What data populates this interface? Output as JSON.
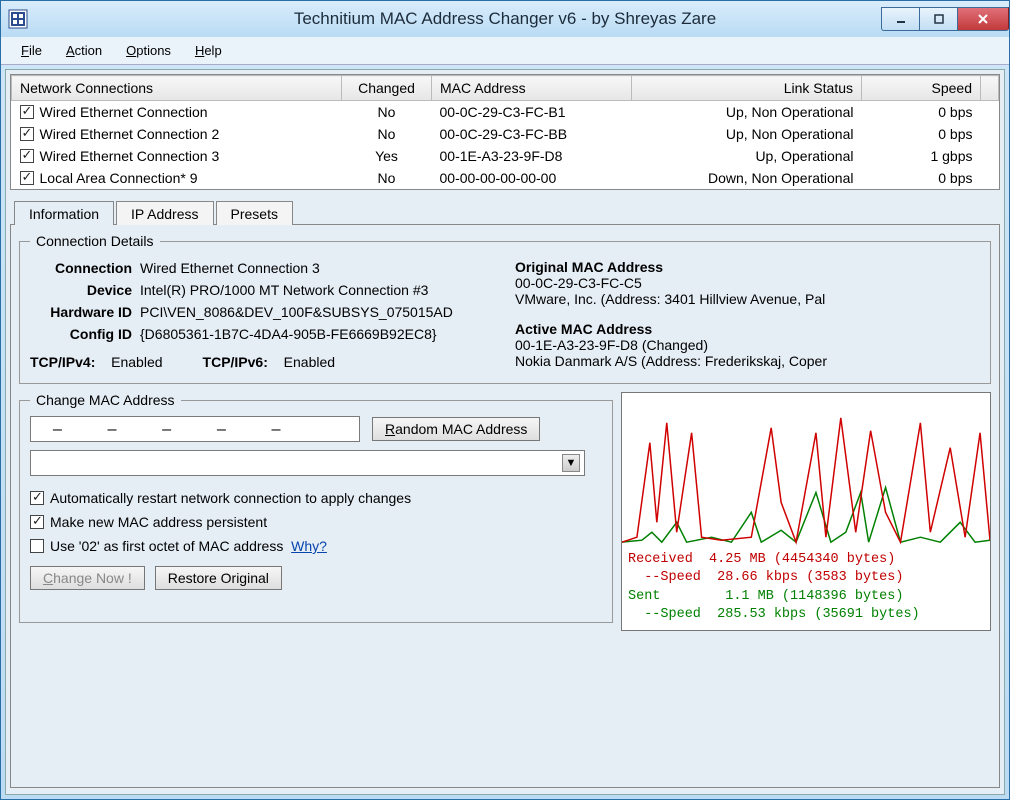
{
  "window": {
    "title": "Technitium MAC Address Changer v6 - by Shreyas Zare"
  },
  "menu": [
    "File",
    "Action",
    "Options",
    "Help"
  ],
  "columns": [
    "Network Connections",
    "Changed",
    "MAC Address",
    "Link Status",
    "Speed"
  ],
  "rows": [
    {
      "name": "Wired Ethernet Connection",
      "changed": "No",
      "mac": "00-0C-29-C3-FC-B1",
      "status": "Up, Non Operational",
      "speed": "0 bps"
    },
    {
      "name": "Wired Ethernet Connection 2",
      "changed": "No",
      "mac": "00-0C-29-C3-FC-BB",
      "status": "Up, Non Operational",
      "speed": "0 bps"
    },
    {
      "name": "Wired Ethernet Connection 3",
      "changed": "Yes",
      "mac": "00-1E-A3-23-9F-D8",
      "status": "Up, Operational",
      "speed": "1 gbps"
    },
    {
      "name": "Local Area Connection* 9",
      "changed": "No",
      "mac": "00-00-00-00-00-00",
      "status": "Down, Non Operational",
      "speed": "0 bps"
    }
  ],
  "tabs": [
    "Information",
    "IP Address",
    "Presets"
  ],
  "fieldset_details": "Connection Details",
  "fieldset_change": "Change MAC Address",
  "details": {
    "connection_lbl": "Connection",
    "connection": "Wired Ethernet Connection 3",
    "device_lbl": "Device",
    "device": "Intel(R) PRO/1000 MT Network Connection #3",
    "hwid_lbl": "Hardware ID",
    "hwid": "PCI\\VEN_8086&DEV_100F&SUBSYS_075015AD",
    "cfgid_lbl": "Config ID",
    "cfgid": "{D6805361-1B7C-4DA4-905B-FE6669B92EC8}",
    "tcpv4_lbl": "TCP/IPv4:",
    "tcpv4": "Enabled",
    "tcpv6_lbl": "TCP/IPv6:",
    "tcpv6": "Enabled",
    "orig_title": "Original MAC Address",
    "orig_mac": "00-0C-29-C3-FC-C5",
    "orig_vendor": "VMware, Inc.  (Address: 3401 Hillview Avenue, Pal",
    "active_title": "Active MAC Address",
    "active_mac": "00-1E-A3-23-9F-D8 (Changed)",
    "active_vendor": "Nokia Danmark A/S  (Address: Frederikskaj, Coper"
  },
  "change": {
    "random_btn": "Random MAC Address",
    "chk_restart": "Automatically restart network connection to apply changes",
    "chk_persist": "Make new MAC address persistent",
    "chk_02": "Use '02' as first octet of MAC address",
    "why": "Why?",
    "change_btn": "Change Now !",
    "restore_btn": "Restore Original"
  },
  "stats": {
    "rx_lbl": "Received",
    "rx": "4.25 MB (4454340 bytes)",
    "rxspd_lbl": "--Speed",
    "rxspd": "28.66 kbps (3583 bytes)",
    "tx_lbl": "Sent",
    "tx": "1.1 MB (1148396 bytes)",
    "txspd_lbl": "--Speed",
    "txspd": "285.53 kbps (35691 bytes)"
  }
}
